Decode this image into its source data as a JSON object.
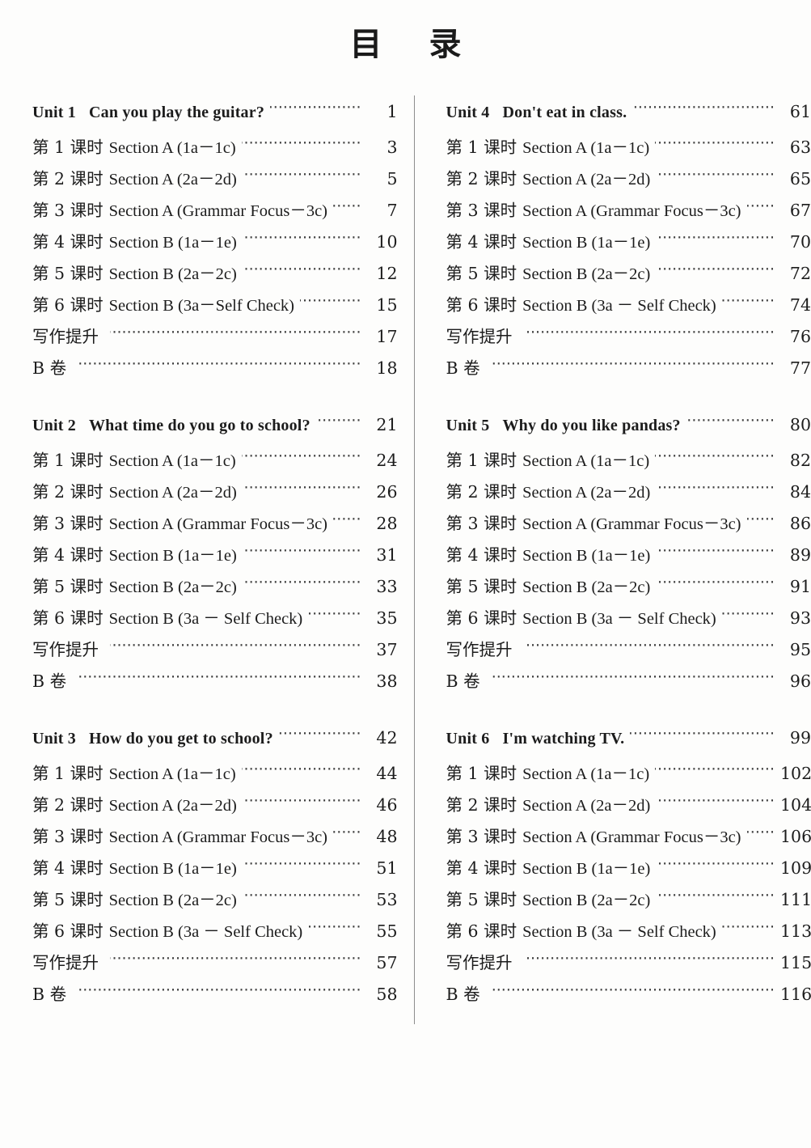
{
  "document": {
    "title": "目  录",
    "title_plain": "目 录"
  },
  "columns": [
    {
      "units": [
        {
          "unit_label": "Unit 1",
          "unit_title": "Can you play the guitar?",
          "unit_page": "1",
          "rows": [
            {
              "tag": "第 1 课时",
              "title": "Section A (1a－1c)",
              "page": "3"
            },
            {
              "tag": "第 2 课时",
              "title": "Section A (2a－2d)",
              "page": "5"
            },
            {
              "tag": "第 3 课时",
              "title": "Section A (Grammar Focus－3c)",
              "page": "7"
            },
            {
              "tag": "第 4 课时",
              "title": "Section B (1a－1e)",
              "page": "10"
            },
            {
              "tag": "第 5 课时",
              "title": "Section B (2a－2c)",
              "page": "12"
            },
            {
              "tag": "第 6 课时",
              "title": "Section B (3a－Self Check)",
              "page": "15"
            },
            {
              "tag": "写作提升",
              "title": "",
              "page": "17"
            },
            {
              "tag": "B 卷",
              "title": "",
              "page": "18"
            }
          ]
        },
        {
          "unit_label": "Unit 2",
          "unit_title": "What time do you go to school?",
          "unit_page": "21",
          "rows": [
            {
              "tag": "第 1 课时",
              "title": "Section A (1a－1c)",
              "page": "24"
            },
            {
              "tag": "第 2 课时",
              "title": "Section A (2a－2d)",
              "page": "26"
            },
            {
              "tag": "第 3 课时",
              "title": "Section A (Grammar Focus－3c)",
              "page": "28"
            },
            {
              "tag": "第 4 课时",
              "title": "Section B (1a－1e)",
              "page": "31"
            },
            {
              "tag": "第 5 课时",
              "title": "Section B (2a－2c)",
              "page": "33"
            },
            {
              "tag": "第 6 课时",
              "title": "Section B (3a － Self Check)",
              "page": "35"
            },
            {
              "tag": "写作提升",
              "title": "",
              "page": "37"
            },
            {
              "tag": "B 卷",
              "title": "",
              "page": "38"
            }
          ]
        },
        {
          "unit_label": "Unit 3",
          "unit_title": "How do you get to school?",
          "unit_page": "42",
          "rows": [
            {
              "tag": "第 1 课时",
              "title": "Section A (1a－1c)",
              "page": "44"
            },
            {
              "tag": "第 2 课时",
              "title": "Section A (2a－2d)",
              "page": "46"
            },
            {
              "tag": "第 3 课时",
              "title": "Section A (Grammar Focus－3c)",
              "page": "48"
            },
            {
              "tag": "第 4 课时",
              "title": "Section B (1a－1e)",
              "page": "51"
            },
            {
              "tag": "第 5 课时",
              "title": "Section B (2a－2c)",
              "page": "53"
            },
            {
              "tag": "第 6 课时",
              "title": "Section B (3a － Self Check)",
              "page": "55"
            },
            {
              "tag": "写作提升",
              "title": "",
              "page": "57"
            },
            {
              "tag": "B 卷",
              "title": "",
              "page": "58"
            }
          ]
        }
      ]
    },
    {
      "units": [
        {
          "unit_label": "Unit 4",
          "unit_title": "Don't eat in class.",
          "unit_page": "61",
          "rows": [
            {
              "tag": "第 1 课时",
              "title": "Section A (1a－1c)",
              "page": "63"
            },
            {
              "tag": "第 2 课时",
              "title": "Section A (2a－2d)",
              "page": "65"
            },
            {
              "tag": "第 3 课时",
              "title": "Section A (Grammar Focus－3c)",
              "page": "67"
            },
            {
              "tag": "第 4 课时",
              "title": "Section B (1a－1e)",
              "page": "70"
            },
            {
              "tag": "第 5 课时",
              "title": "Section B (2a－2c)",
              "page": "72"
            },
            {
              "tag": "第 6 课时",
              "title": "Section B (3a － Self Check)",
              "page": "74"
            },
            {
              "tag": "写作提升",
              "title": "",
              "page": "76"
            },
            {
              "tag": "B 卷",
              "title": "",
              "page": "77"
            }
          ]
        },
        {
          "unit_label": "Unit 5",
          "unit_title": "Why do you like pandas?",
          "unit_page": "80",
          "rows": [
            {
              "tag": "第 1 课时",
              "title": "Section A (1a－1c)",
              "page": "82"
            },
            {
              "tag": "第 2 课时",
              "title": "Section A (2a－2d)",
              "page": "84"
            },
            {
              "tag": "第 3 课时",
              "title": "Section A (Grammar Focus－3c)",
              "page": "86"
            },
            {
              "tag": "第 4 课时",
              "title": "Section B (1a－1e)",
              "page": "89"
            },
            {
              "tag": "第 5 课时",
              "title": "Section B (2a－2c)",
              "page": "91"
            },
            {
              "tag": "第 6 课时",
              "title": "Section B (3a － Self Check)",
              "page": "93"
            },
            {
              "tag": "写作提升",
              "title": "",
              "page": "95"
            },
            {
              "tag": "B 卷",
              "title": "",
              "page": "96"
            }
          ]
        },
        {
          "unit_label": "Unit 6",
          "unit_title": "I'm watching TV.",
          "unit_page": "99",
          "rows": [
            {
              "tag": "第 1 课时",
              "title": "Section A (1a－1c)",
              "page": "102"
            },
            {
              "tag": "第 2 课时",
              "title": "Section A (2a－2d)",
              "page": "104"
            },
            {
              "tag": "第 3 课时",
              "title": "Section A (Grammar Focus－3c)",
              "page": "106"
            },
            {
              "tag": "第 4 课时",
              "title": "Section B (1a－1e)",
              "page": "109"
            },
            {
              "tag": "第 5 课时",
              "title": "Section B (2a－2c)",
              "page": "111"
            },
            {
              "tag": "第 6 课时",
              "title": "Section B (3a － Self Check)",
              "page": "113"
            },
            {
              "tag": "写作提升",
              "title": "",
              "page": "115"
            },
            {
              "tag": "B 卷",
              "title": "",
              "page": "116"
            }
          ]
        }
      ]
    }
  ]
}
